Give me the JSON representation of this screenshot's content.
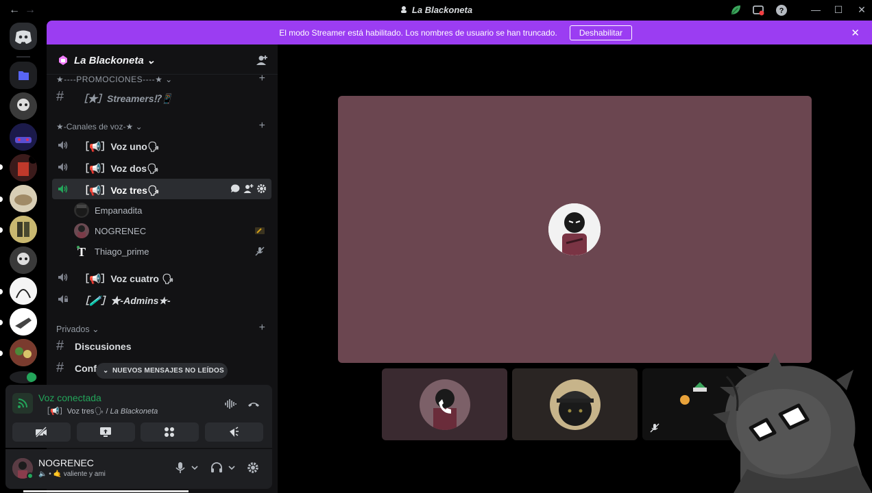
{
  "window": {
    "title": "La Blackoneta",
    "back_label": "←",
    "forward_label": "→",
    "minimize_label": "—",
    "maximize_label": "☐",
    "close_label": "✕"
  },
  "banner": {
    "text": "El modo Streamer está habilitado. Los nombres de usuario se han truncado.",
    "button_label": "Deshabilitar",
    "close_label": "✕"
  },
  "server": {
    "name": "La Blackoneta"
  },
  "categories": {
    "promociones": "★----PROMOCIONES----★",
    "voz": "★-Canales de voz-★",
    "privados": "Privados",
    "chevron": "⌄",
    "plus": "+"
  },
  "channels": {
    "streamers": "［★］Streamers⁉📱",
    "voz_uno": "［📢］Voz uno🗣",
    "voz_dos": "［📢］Voz dos🗣",
    "voz_tres": "［📢］Voz tres🗣",
    "voz_cuatro": "［📢］Voz cuatro 🗣",
    "admins": "［🧪］★-Admins★-",
    "discusiones": "Discusiones",
    "conf": "Conf"
  },
  "voice_users": [
    {
      "name": "Empanadita"
    },
    {
      "name": "NOGRENEC"
    },
    {
      "name": "Thiago_prime"
    }
  ],
  "unread_pill": "NUEVOS MENSAJES NO LEÍDOS",
  "voice_panel": {
    "status": "Voz conectada",
    "channel_label": "［📢］Voz tres🗣 / ",
    "server_label": "La Blackoneta"
  },
  "user": {
    "name": "NOGRENEC",
    "status": "🔈 • 🤙 valiente y ami"
  },
  "colors": {
    "accent": "#9b3df2",
    "connected": "#23a55a",
    "stage_bg": "#6b4650"
  }
}
